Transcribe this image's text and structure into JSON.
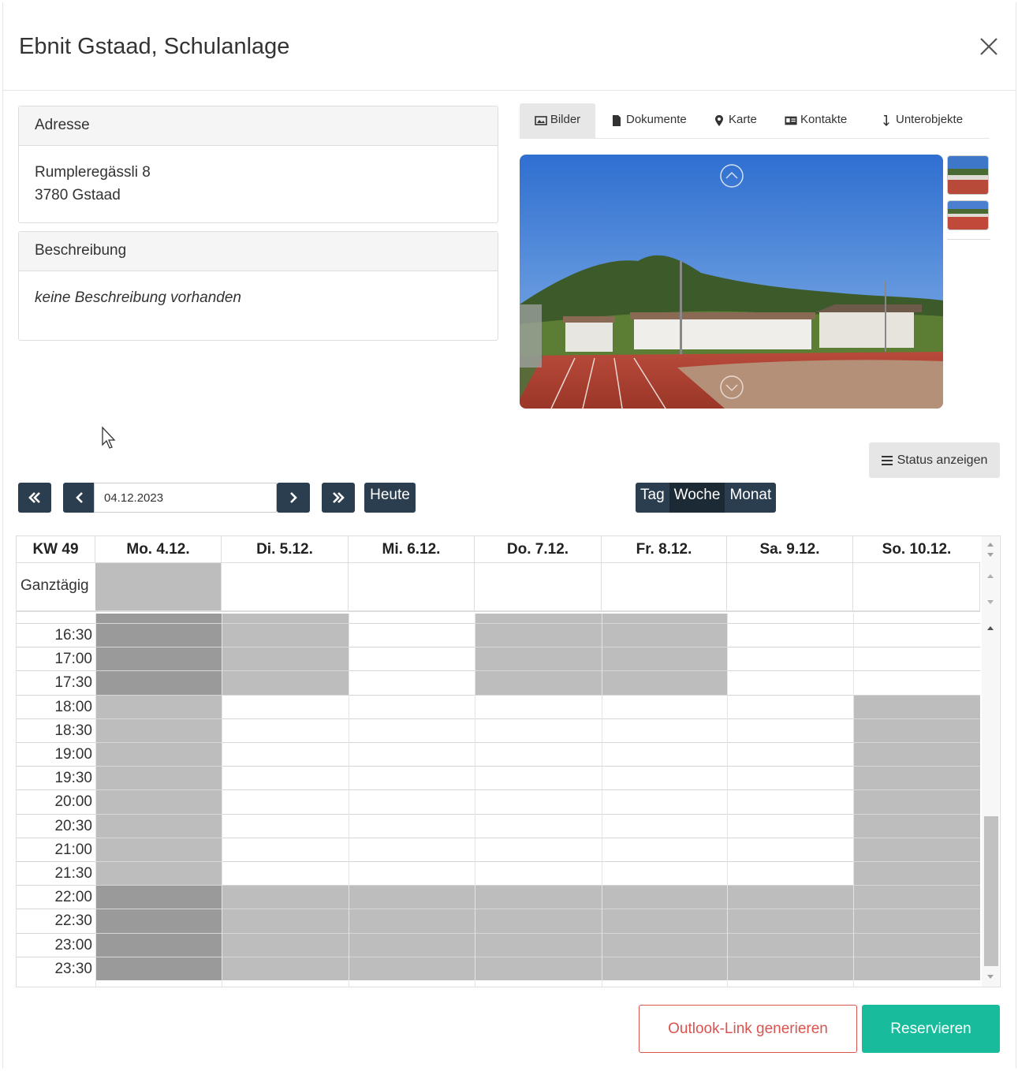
{
  "modal": {
    "title": "Ebnit Gstaad, Schulanlage",
    "close_icon": "close-icon"
  },
  "address": {
    "heading": "Adresse",
    "line1": "Rumpleregässli 8",
    "line2": "3780 Gstaad"
  },
  "description": {
    "heading": "Beschreibung",
    "text": "keine Beschreibung vorhanden"
  },
  "tabs": [
    {
      "label": "Bilder",
      "icon": "image-icon",
      "active": true
    },
    {
      "label": "Dokumente",
      "icon": "file-icon",
      "active": false
    },
    {
      "label": "Karte",
      "icon": "map-marker-icon",
      "active": false
    },
    {
      "label": "Kontakte",
      "icon": "contact-card-icon",
      "active": false
    },
    {
      "label": "Unterobjekte",
      "icon": "arrow-down-icon",
      "active": false
    }
  ],
  "status_button": {
    "label": "Status anzeigen",
    "icon": "list-icon"
  },
  "toolbar": {
    "date_value": "04.12.2023",
    "today_label": "Heute",
    "views": [
      {
        "label": "Tag",
        "active": false
      },
      {
        "label": "Woche",
        "active": true
      },
      {
        "label": "Monat",
        "active": false
      }
    ]
  },
  "calendar": {
    "week_label": "KW 49",
    "allday_label": "Ganztägig",
    "days": [
      "Mo. 4.12.",
      "Di. 5.12.",
      "Mi. 6.12.",
      "Do. 7.12.",
      "Fr. 8.12.",
      "Sa. 9.12.",
      "So. 10.12."
    ],
    "times": [
      "16:30",
      "17:00",
      "17:30",
      "18:00",
      "18:30",
      "19:00",
      "19:30",
      "20:00",
      "20:30",
      "21:00",
      "21:30",
      "22:00",
      "22:30",
      "23:00",
      "23:30"
    ],
    "allday_status": [
      "occupied",
      "free",
      "free",
      "free",
      "free",
      "free",
      "free"
    ],
    "status_legend": {
      "free": "#ffffff",
      "occupied": "#bdbdbd",
      "blocked": "#9a9a9a"
    },
    "slots": [
      [
        "blocked",
        "occupied",
        "free",
        "occupied",
        "occupied",
        "free",
        "free"
      ],
      [
        "blocked",
        "occupied",
        "free",
        "occupied",
        "occupied",
        "free",
        "free"
      ],
      [
        "blocked",
        "occupied",
        "free",
        "occupied",
        "occupied",
        "free",
        "free"
      ],
      [
        "occupied",
        "free",
        "free",
        "free",
        "free",
        "free",
        "occupied"
      ],
      [
        "occupied",
        "free",
        "free",
        "free",
        "free",
        "free",
        "occupied"
      ],
      [
        "occupied",
        "free",
        "free",
        "free",
        "free",
        "free",
        "occupied"
      ],
      [
        "occupied",
        "free",
        "free",
        "free",
        "free",
        "free",
        "occupied"
      ],
      [
        "occupied",
        "free",
        "free",
        "free",
        "free",
        "free",
        "occupied"
      ],
      [
        "occupied",
        "free",
        "free",
        "free",
        "free",
        "free",
        "occupied"
      ],
      [
        "occupied",
        "free",
        "free",
        "free",
        "free",
        "free",
        "occupied"
      ],
      [
        "occupied",
        "free",
        "free",
        "free",
        "free",
        "free",
        "occupied"
      ],
      [
        "blocked",
        "occupied",
        "occupied",
        "occupied",
        "occupied",
        "occupied",
        "occupied"
      ],
      [
        "blocked",
        "occupied",
        "occupied",
        "occupied",
        "occupied",
        "occupied",
        "occupied"
      ],
      [
        "blocked",
        "occupied",
        "occupied",
        "occupied",
        "occupied",
        "occupied",
        "occupied"
      ],
      [
        "blocked",
        "occupied",
        "occupied",
        "occupied",
        "occupied",
        "occupied",
        "occupied"
      ]
    ]
  },
  "footer": {
    "outlook_label": "Outlook-Link generieren",
    "reserve_label": "Reservieren",
    "outlook_color": "#d9534f",
    "reserve_color": "#18bc9c"
  }
}
